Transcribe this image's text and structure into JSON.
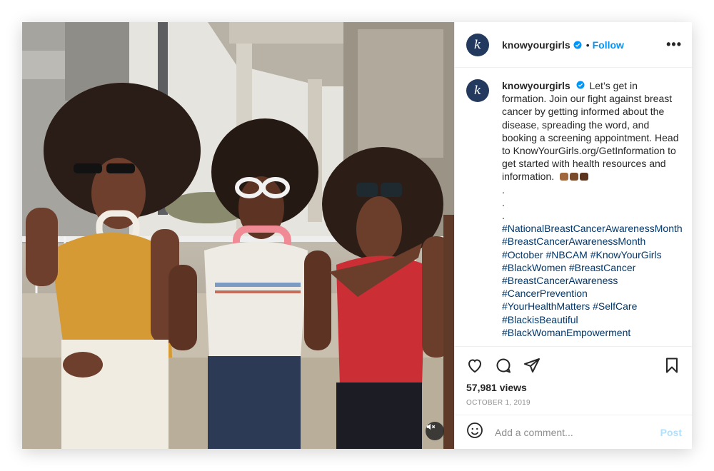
{
  "post": {
    "username": "knowyourgirls",
    "follow_label": "Follow",
    "dot": "•",
    "more_label": "•••",
    "avatar_letter": "k"
  },
  "caption": {
    "username": "knowyourgirls",
    "text": "Let’s get in formation. Join our fight against breast cancer by getting informed about the disease, spreading the word, and booking a screening appointment. Head to KnowYourGirls.org/GetInformation to get started with health resources and information.",
    "dots": [
      ".",
      ".",
      "."
    ],
    "hashtags": [
      "#NationalBreastCancerAwarenessMonth #BreastCancerAwarenessMonth",
      "#October #NBCAM #KnowYourGirls",
      "#BlackWomen #BreastCancer",
      "#BreastCancerAwareness",
      "#CancerPrevention",
      "#YourHealthMatters #SelfCare",
      "#BlackisBeautiful",
      "#BlackWomanEmpowerment"
    ]
  },
  "stats": {
    "views": "57,981 views",
    "date": "OCTOBER 1, 2019"
  },
  "comment_box": {
    "placeholder": "Add a comment...",
    "post_label": "Post"
  },
  "colors": {
    "accent": "#0095f6",
    "hashtag": "#00376b",
    "muted": "#8e8e8e",
    "avatar_bg": "#233a5e"
  },
  "icons": [
    "verified-badge-icon",
    "more-options-icon",
    "heart-icon",
    "comment-icon",
    "share-icon",
    "bookmark-icon",
    "emoji-icon",
    "mute-icon"
  ]
}
